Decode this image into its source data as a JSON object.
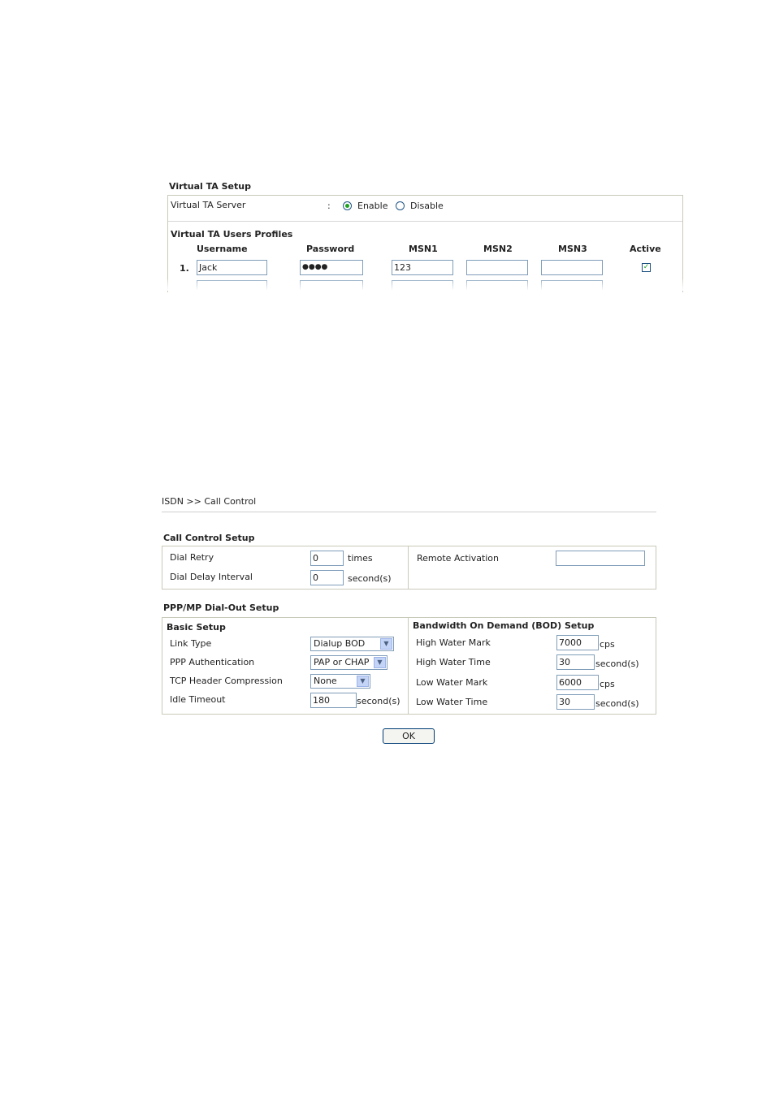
{
  "virtual_ta": {
    "section_title": "Virtual TA Setup",
    "server_label": "Virtual TA Server",
    "colon": ":",
    "enable_label": "Enable",
    "disable_label": "Disable",
    "server_selected": "Enable",
    "profiles_title": "Virtual TA Users Profiles",
    "columns": [
      "Username",
      "Password",
      "MSN1",
      "MSN2",
      "MSN3",
      "Active"
    ],
    "rows": [
      {
        "index": "1.",
        "username": "Jack",
        "password": "●●●●",
        "msn1": "123",
        "msn2": "",
        "msn3": "",
        "active": true
      }
    ]
  },
  "call_control": {
    "breadcrumb": "ISDN >> Call Control",
    "setup_title": "Call Control Setup",
    "dial_retry_label": "Dial Retry",
    "dial_retry_value": "0",
    "dial_retry_unit": "times",
    "dial_delay_label": "Dial Delay Interval",
    "dial_delay_value": "0",
    "dial_delay_unit": "second(s)",
    "remote_activation_label": "Remote Activation",
    "remote_activation_value": "",
    "ppp_title": "PPP/MP Dial-Out Setup",
    "basic_setup_title": "Basic Setup",
    "link_type_label": "Link Type",
    "link_type_value": "Dialup BOD",
    "ppp_auth_label": "PPP Authentication",
    "ppp_auth_value": "PAP or CHAP",
    "tcp_header_label": "TCP Header Compression",
    "tcp_header_value": "None",
    "idle_timeout_label": "Idle Timeout",
    "idle_timeout_value": "180",
    "idle_timeout_unit": "second(s)",
    "bod_title": "Bandwidth On Demand (BOD) Setup",
    "high_water_mark_label": "High Water Mark",
    "high_water_mark_value": "7000",
    "high_water_mark_unit": "cps",
    "high_water_time_label": "High Water Time",
    "high_water_time_value": "30",
    "high_water_time_unit": "second(s)",
    "low_water_mark_label": "Low Water Mark",
    "low_water_mark_value": "6000",
    "low_water_mark_unit": "cps",
    "low_water_time_label": "Low Water Time",
    "low_water_time_value": "30",
    "low_water_time_unit": "second(s)",
    "ok_label": "OK"
  },
  "icons": {
    "dropdown": "chevron-down-icon",
    "check": "checkmark-icon"
  },
  "colors": {
    "frame_border": "#c9c9b9",
    "input_border": "#7f9db9",
    "radio_dot": "#21a121",
    "dropdown_button": "#c4d4f7"
  }
}
